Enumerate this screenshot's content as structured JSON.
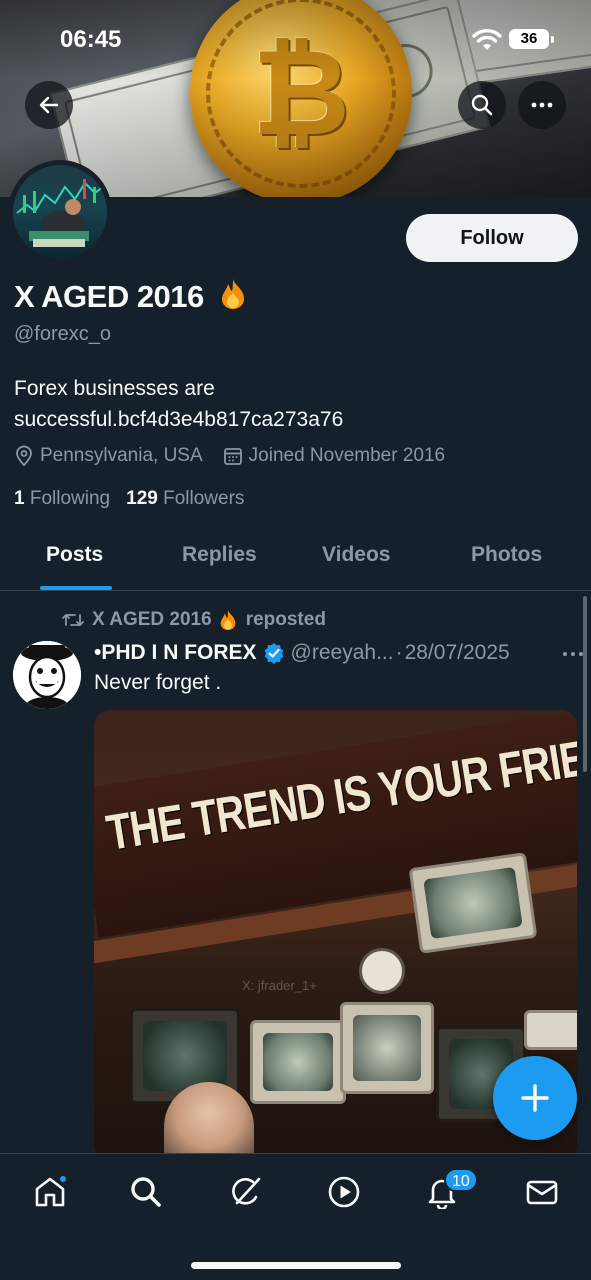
{
  "status_bar": {
    "time": "06:45",
    "battery": "36"
  },
  "profile": {
    "display_name": "X AGED 2016",
    "handle": "@forexc_o",
    "bio": "Forex businesses are successful.bcf4d3e4b817ca273a76",
    "location": "Pennsylvania, USA",
    "joined": "Joined November 2016",
    "following_count": "1",
    "following_label": "Following",
    "followers_count": "129",
    "followers_label": "Followers",
    "follow_button": "Follow"
  },
  "tabs": [
    {
      "label": "Posts",
      "active": true
    },
    {
      "label": "Replies",
      "active": false
    },
    {
      "label": "Videos",
      "active": false
    },
    {
      "label": "Photos",
      "active": false
    }
  ],
  "post": {
    "repost_by": "X AGED 2016",
    "repost_label": "reposted",
    "author_name": "•PHD I N FOREX",
    "author_handle": "@reeyah...",
    "separator": "·",
    "date": "28/07/2025",
    "text": "Never forget .",
    "media_text": "THE TREND IS YOUR FRIEND",
    "media_watermark": "X: jfrader_1+"
  },
  "bottom_nav": {
    "notifications_badge": "10"
  },
  "icons": {
    "back": "arrow-left-icon",
    "search": "search-icon",
    "more": "more-icon",
    "location": "location-pin-icon",
    "calendar": "calendar-icon",
    "repost": "repost-icon",
    "verified": "verified-badge-icon",
    "compose": "plus-icon",
    "fire": "fire-emoji-icon"
  },
  "colors": {
    "background": "#15202b",
    "accent": "#1d9bf0",
    "text_primary": "#f7f9f9",
    "text_secondary": "#8b98a5",
    "divider": "#38444d"
  }
}
